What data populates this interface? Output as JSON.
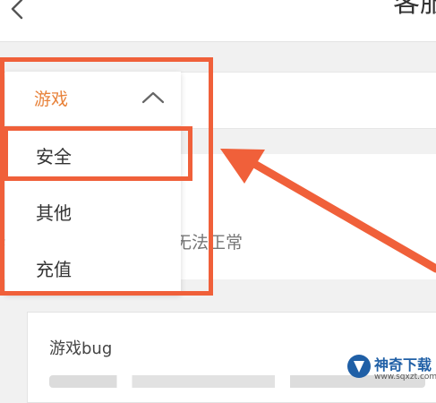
{
  "header": {
    "title": "客服"
  },
  "dropdown": {
    "selected": "游戏",
    "options": [
      "安全",
      "其他",
      "充值"
    ]
  },
  "description": {
    "text": "频繁掉线等现象，导致无法正常"
  },
  "card2": {
    "title": "游戏bug"
  },
  "watermark": {
    "title": "神奇下载",
    "url": "www.sqxzt.com"
  },
  "colors": {
    "accent": "#e8823a",
    "highlight": "#f0603a",
    "brand": "#1f5fa6"
  }
}
